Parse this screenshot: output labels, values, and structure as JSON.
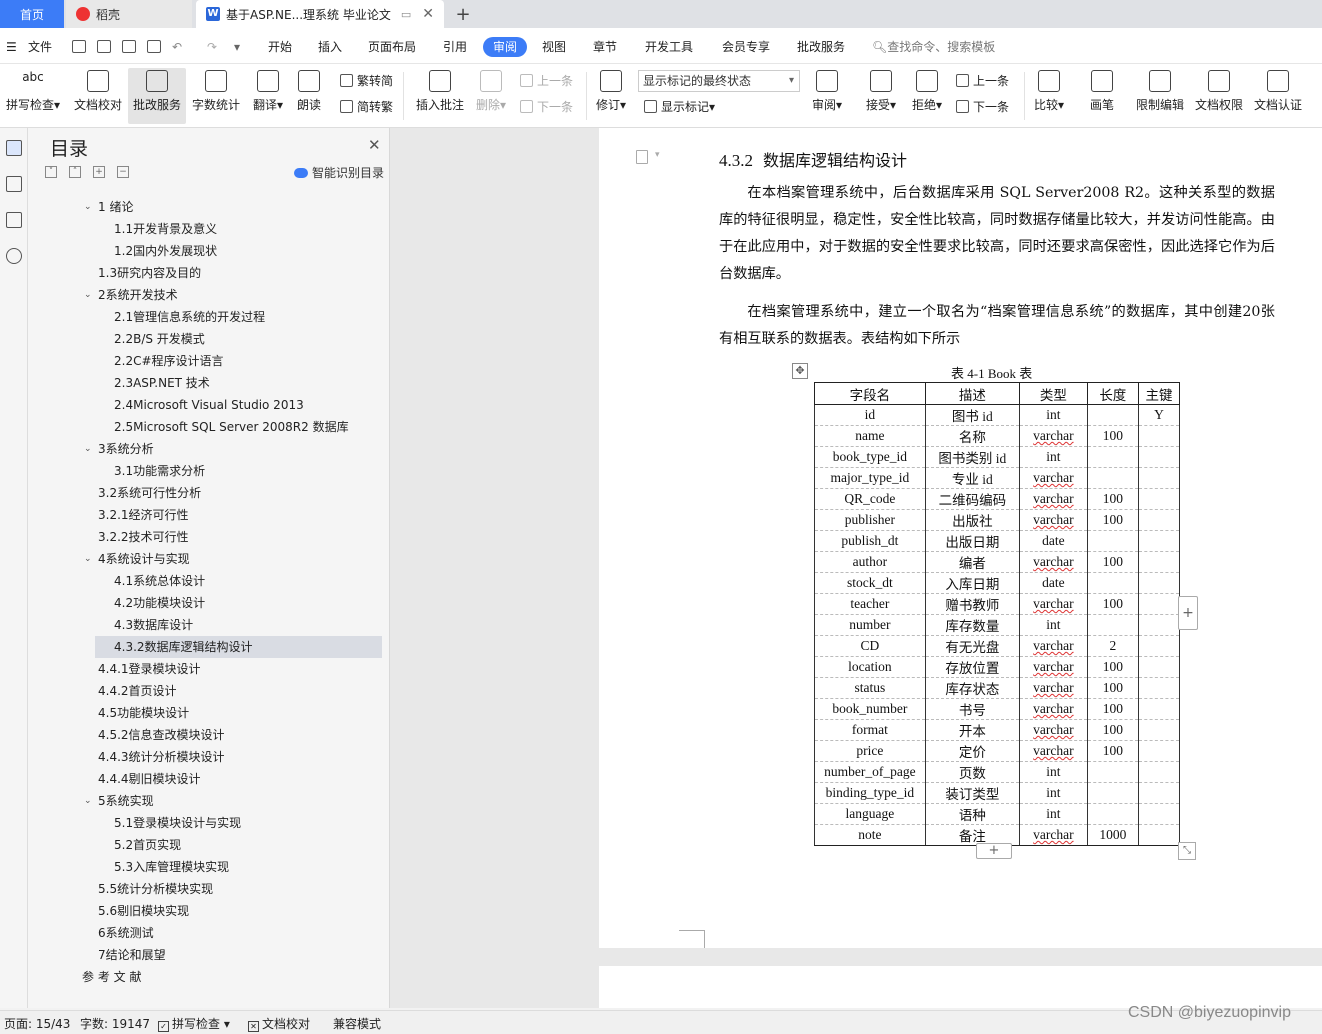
{
  "tabs": {
    "home": "首页",
    "daoke": "稻壳",
    "doc": "基于ASP.NE...理系统 毕业论文",
    "add": "+",
    "close": "✕"
  },
  "menu": {
    "file": "文件",
    "items": [
      "开始",
      "插入",
      "页面布局",
      "引用",
      "审阅",
      "视图",
      "章节",
      "开发工具",
      "会员专享",
      "批改服务"
    ],
    "active": "审阅",
    "search": "查找命令、搜索模板"
  },
  "ribbon": {
    "spell": "拼写检查",
    "doccheck": "文档校对",
    "review_service": "批改服务",
    "wordcount": "字数统计",
    "translate": "翻译",
    "read": "朗读",
    "to_trad": "繁转简",
    "to_simp": "简转繁",
    "insert_comment": "插入批注",
    "delete": "删除",
    "prev": "上一条",
    "next": "下一条",
    "revise": "修订",
    "markup_select": "显示标记的最终状态",
    "show_markup": "显示标记",
    "review": "审阅",
    "accept": "接受",
    "reject": "拒绝",
    "prev2": "上一条",
    "next2": "下一条",
    "compare": "比较",
    "pen": "画笔",
    "restrict": "限制编辑",
    "permission": "文档权限",
    "certify": "文档认证"
  },
  "toc": {
    "title": "目录",
    "close": "✕",
    "smart": "智能识别目录",
    "items": [
      {
        "label": "1 绪论",
        "level": 1,
        "chev": true
      },
      {
        "label": "1.1开发背景及意义",
        "level": 2
      },
      {
        "label": "1.2国内外发展现状",
        "level": 2
      },
      {
        "label": "1.3研究内容及目的",
        "level": 1
      },
      {
        "label": "2系统开发技术",
        "level": 1,
        "chev": true
      },
      {
        "label": "2.1管理信息系统的开发过程",
        "level": 2
      },
      {
        "label": "2.2B/S 开发模式",
        "level": 2
      },
      {
        "label": "2.2C#程序设计语言",
        "level": 2
      },
      {
        "label": "2.3ASP.NET 技术",
        "level": 2
      },
      {
        "label": "2.4Microsoft Visual Studio 2013",
        "level": 2
      },
      {
        "label": "2.5Microsoft SQL Server 2008R2 数据库",
        "level": 2
      },
      {
        "label": "3系统分析",
        "level": 1,
        "chev": true
      },
      {
        "label": "3.1功能需求分析",
        "level": 2
      },
      {
        "label": "3.2系统可行性分析",
        "level": 1
      },
      {
        "label": "3.2.1经济可行性",
        "level": 1
      },
      {
        "label": "3.2.2技术可行性",
        "level": 1
      },
      {
        "label": "4系统设计与实现",
        "level": 1,
        "chev": true
      },
      {
        "label": "4.1系统总体设计",
        "level": 2
      },
      {
        "label": "4.2功能模块设计",
        "level": 2
      },
      {
        "label": "4.3数据库设计",
        "level": 2
      },
      {
        "label": "4.3.2数据库逻辑结构设计",
        "level": 2,
        "selected": true
      },
      {
        "label": "4.4.1登录模块设计",
        "level": 1
      },
      {
        "label": "4.4.2首页设计",
        "level": 1
      },
      {
        "label": "4.5功能模块设计",
        "level": 1
      },
      {
        "label": "4.5.2信息查改模块设计",
        "level": 1
      },
      {
        "label": "4.4.3统计分析模块设计",
        "level": 1
      },
      {
        "label": "4.4.4剔旧模块设计",
        "level": 1
      },
      {
        "label": "5系统实现",
        "level": 1,
        "chev": true
      },
      {
        "label": "5.1登录模块设计与实现",
        "level": 2
      },
      {
        "label": "5.2首页实现",
        "level": 2
      },
      {
        "label": "5.3入库管理模块实现",
        "level": 2
      },
      {
        "label": "5.5统计分析模块实现",
        "level": 1
      },
      {
        "label": "5.6剔旧模块实现",
        "level": 1
      },
      {
        "label": "6系统测试",
        "level": 1
      },
      {
        "label": "7结论和展望",
        "level": 1
      },
      {
        "label": "参 考 文 献",
        "level": 0
      }
    ]
  },
  "document": {
    "heading_num": "4.3.2",
    "heading_text": "数据库逻辑结构设计",
    "para1": "在本档案管理系统中，后台数据库采用 SQL Server2008 R2。这种关系型的数据库的特征很明显，稳定性，安全性比较高，同时数据存储量比较大，并发访问性能高。由于在此应用中，对于数据的安全性要求比较高，同时还要求高保密性，因此选择它作为后台数据库。",
    "para2": "在档案管理系统中，建立一个取名为“档案管理信息系统”的数据库，其中创建20张有相互联系的数据表。表结构如下所示",
    "table_caption": "表 4-1 Book 表",
    "table": {
      "headers": [
        "字段名",
        "描述",
        "类型",
        "长度",
        "主键"
      ],
      "rows": [
        [
          "id",
          "图书 id",
          "int",
          "",
          "Y"
        ],
        [
          "name",
          "名称",
          "varchar",
          "100",
          ""
        ],
        [
          "book_type_id",
          "图书类别 id",
          "int",
          "",
          ""
        ],
        [
          "major_type_id",
          "专业 id",
          "varchar",
          "",
          ""
        ],
        [
          "QR_code",
          "二维码编码",
          "varchar",
          "100",
          ""
        ],
        [
          "publisher",
          "出版社",
          "varchar",
          "100",
          ""
        ],
        [
          "publish_dt",
          "出版日期",
          "date",
          "",
          ""
        ],
        [
          "author",
          "编者",
          "varchar",
          "100",
          ""
        ],
        [
          "stock_dt",
          "入库日期",
          "date",
          "",
          ""
        ],
        [
          "teacher",
          "赠书教师",
          "varchar",
          "100",
          ""
        ],
        [
          "number",
          "库存数量",
          "int",
          "",
          ""
        ],
        [
          "CD",
          "有无光盘",
          "varchar",
          "2",
          ""
        ],
        [
          "location",
          "存放位置",
          "varchar",
          "100",
          ""
        ],
        [
          "status",
          "库存状态",
          "varchar",
          "100",
          ""
        ],
        [
          "book_number",
          "书号",
          "varchar",
          "100",
          ""
        ],
        [
          "format",
          "开本",
          "varchar",
          "100",
          ""
        ],
        [
          "price",
          "定价",
          "varchar",
          "100",
          ""
        ],
        [
          "number_of_page",
          "页数",
          "int",
          "",
          ""
        ],
        [
          "binding_type_id",
          "装订类型",
          "int",
          "",
          ""
        ],
        [
          "language",
          "语种",
          "int",
          "",
          ""
        ],
        [
          "note",
          "备注",
          "varchar",
          "1000",
          ""
        ]
      ]
    }
  },
  "status": {
    "page": "页面: 15/43",
    "words": "字数: 19147",
    "spell": "拼写检查",
    "doccheck": "文档校对",
    "compat": "兼容模式"
  },
  "watermark": "CSDN @biyezuopinvip"
}
